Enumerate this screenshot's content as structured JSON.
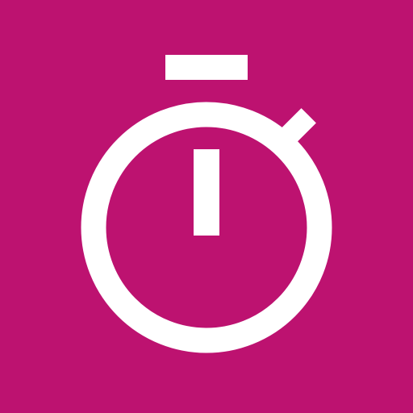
{
  "app": {
    "icon": "stopwatch-icon",
    "colors": {
      "background": "#BD1270",
      "foreground": "#FFFFFF"
    }
  }
}
